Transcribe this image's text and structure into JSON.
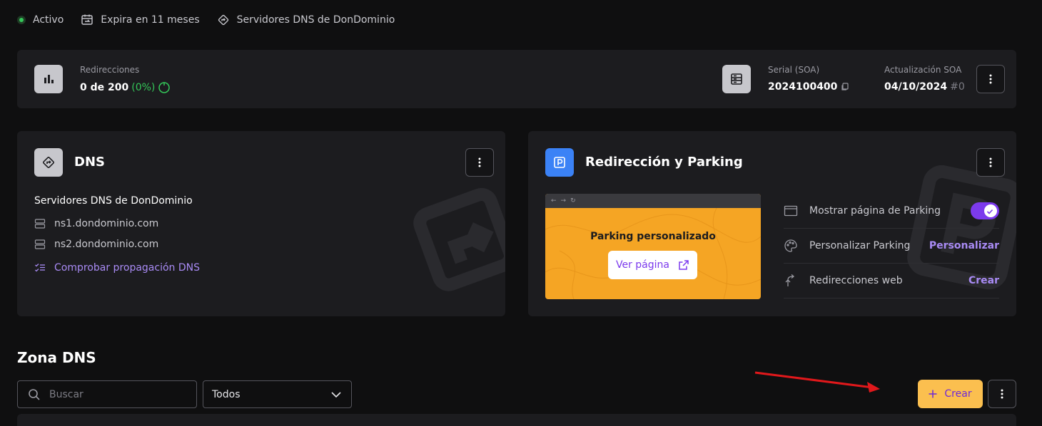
{
  "status": {
    "active": "Activo",
    "expires": "Expira en 11 meses",
    "dns_servers": "Servidores DNS de DonDominio"
  },
  "stats": {
    "redirections_label": "Redirecciones",
    "redirections_value": "0 de 200",
    "redirections_percent": "(0%)",
    "serial_label": "Serial (SOA)",
    "serial_value": "2024100400",
    "update_label": "Actualización SOA",
    "update_date": "04/10/2024",
    "update_number": "#0"
  },
  "dns_card": {
    "title": "DNS",
    "subtitle": "Servidores DNS de DonDominio",
    "nameservers": [
      "ns1.dondominio.com",
      "ns2.dondominio.com"
    ],
    "check_link": "Comprobar propagación DNS"
  },
  "parking_card": {
    "title": "Redirección y Parking",
    "preview_title": "Parking personalizado",
    "preview_button": "Ver página",
    "options": [
      {
        "label": "Mostrar página de Parking",
        "action": ""
      },
      {
        "label": "Personalizar Parking",
        "action": "Personalizar"
      },
      {
        "label": "Redirecciones web",
        "action": "Crear"
      }
    ],
    "parking_enabled": true
  },
  "zona": {
    "title": "Zona DNS",
    "search_placeholder": "Buscar",
    "filter_value": "Todos",
    "create_label": "Crear"
  },
  "colors": {
    "accent": "#7c3aed",
    "link": "#a98bf5",
    "create_button": "#fbbf4f",
    "status_active": "#34c759",
    "annotation_arrow": "#e0181b"
  }
}
